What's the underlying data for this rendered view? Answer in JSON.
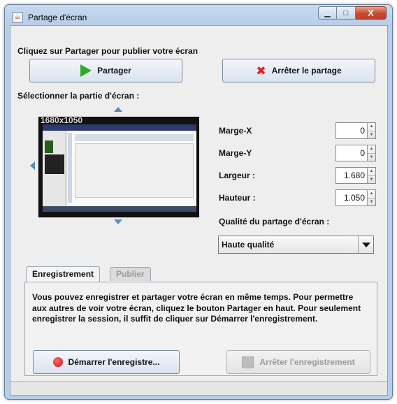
{
  "window": {
    "title": "Partage d'écran"
  },
  "titlebar": {
    "min_glyph": "▁",
    "max_glyph": "□",
    "close_glyph": "X"
  },
  "share": {
    "instruction": "Cliquez sur Partager pour publier votre écran",
    "share_button": "Partager",
    "stop_button": "Arrêter le partage"
  },
  "selection": {
    "label": "Sélectionner la partie d'écran :",
    "preview_label": "1680x1050"
  },
  "fields": [
    {
      "label": "Marge-X",
      "value": "0"
    },
    {
      "label": "Marge-Y",
      "value": "0"
    },
    {
      "label": "Largeur :",
      "value": "1.680"
    },
    {
      "label": "Hauteur :",
      "value": "1.050"
    }
  ],
  "quality": {
    "label": "Qualité du partage d'écran :",
    "selected": "Haute qualité"
  },
  "tabs": [
    {
      "label": "Enregistrement",
      "active": true
    },
    {
      "label": "Publier",
      "active": false
    }
  ],
  "recording": {
    "description": "Vous pouvez enregistrer et partager votre écran en même temps. Pour permettre aux autres de voir votre écran, cliquez le bouton Partager en haut. Pour seulement enregistrer la session, il suffit de cliquer sur Démarrer l'enregistrement.",
    "start_button": "Démarrer l'enregistre...",
    "stop_button": "Arrêter l'enregistrement"
  },
  "colors": {
    "accent": "#5b87c4",
    "play": "#2fa82f",
    "stop": "#e0201c",
    "record": "#d30f0f"
  }
}
